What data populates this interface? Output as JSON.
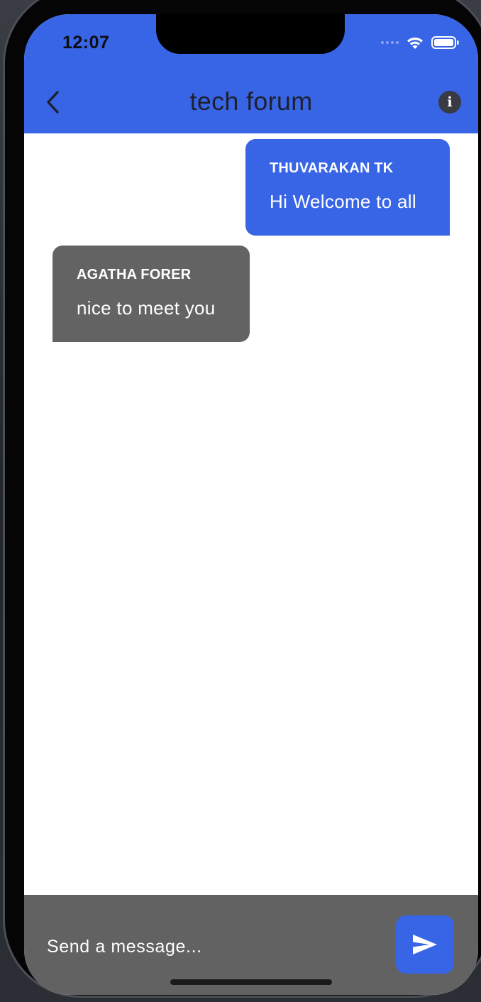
{
  "status_bar": {
    "time": "12:07"
  },
  "app_bar": {
    "title": "tech forum",
    "back_icon": "chevron-left-icon",
    "info_icon": "info-icon",
    "color": "#3865e5"
  },
  "messages": [
    {
      "sender": "THUVARAKAN TK",
      "text": "Hi Welcome to all",
      "direction": "sent",
      "color": "#3865e5"
    },
    {
      "sender": "AGATHA FORER",
      "text": "nice to meet you",
      "direction": "received",
      "color": "#636363"
    }
  ],
  "composer": {
    "placeholder": "Send a message...",
    "value": "",
    "send_icon": "send-icon"
  }
}
